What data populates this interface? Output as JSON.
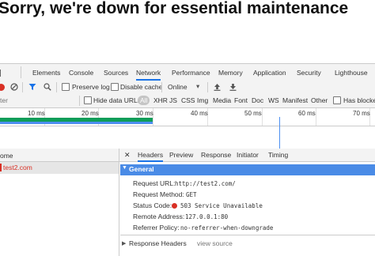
{
  "page": {
    "heading": "Sorry, we're down for essential maintenance"
  },
  "devtools": {
    "tabs": [
      "Elements",
      "Console",
      "Sources",
      "Network",
      "Performance",
      "Memory",
      "Application",
      "Security",
      "Lighthouse"
    ],
    "active_tab": "Network",
    "toolbar": {
      "preserve_log": "Preserve log",
      "disable_cache": "Disable cache",
      "throttle": "Online",
      "throttle_caret": "▾"
    },
    "filter": {
      "placeholder": "ter",
      "hide_data_urls": "Hide data URLs",
      "types": [
        "All",
        "XHR",
        "JS",
        "CSS",
        "Img",
        "Media",
        "Font",
        "Doc",
        "WS",
        "Manifest",
        "Other"
      ],
      "has_blocked": "Has blocked"
    },
    "timeline": {
      "ticks": [
        "10 ms",
        "20 ms",
        "30 ms",
        "40 ms",
        "50 ms",
        "60 ms",
        "70 ms"
      ]
    },
    "list": {
      "header": "ome",
      "rows": [
        {
          "name": "test2.com"
        }
      ]
    },
    "detail": {
      "close": "✕",
      "tabs": [
        "Headers",
        "Preview",
        "Response",
        "Initiator",
        "Timing"
      ],
      "active_tab": "Headers",
      "general_title": "General",
      "general": {
        "url_key": "Request URL:",
        "url_val": "http://test2.com/",
        "method_key": "Request Method:",
        "method_val": "GET",
        "status_key": "Status Code:",
        "status_val": "503 Service Unavailable",
        "remote_key": "Remote Address:",
        "remote_val": "127.0.0.1:80",
        "referrer_key": "Referrer Policy:",
        "referrer_val": "no-referrer-when-downgrade"
      },
      "response_headers_title": "Response Headers",
      "view_source": "view source"
    }
  }
}
